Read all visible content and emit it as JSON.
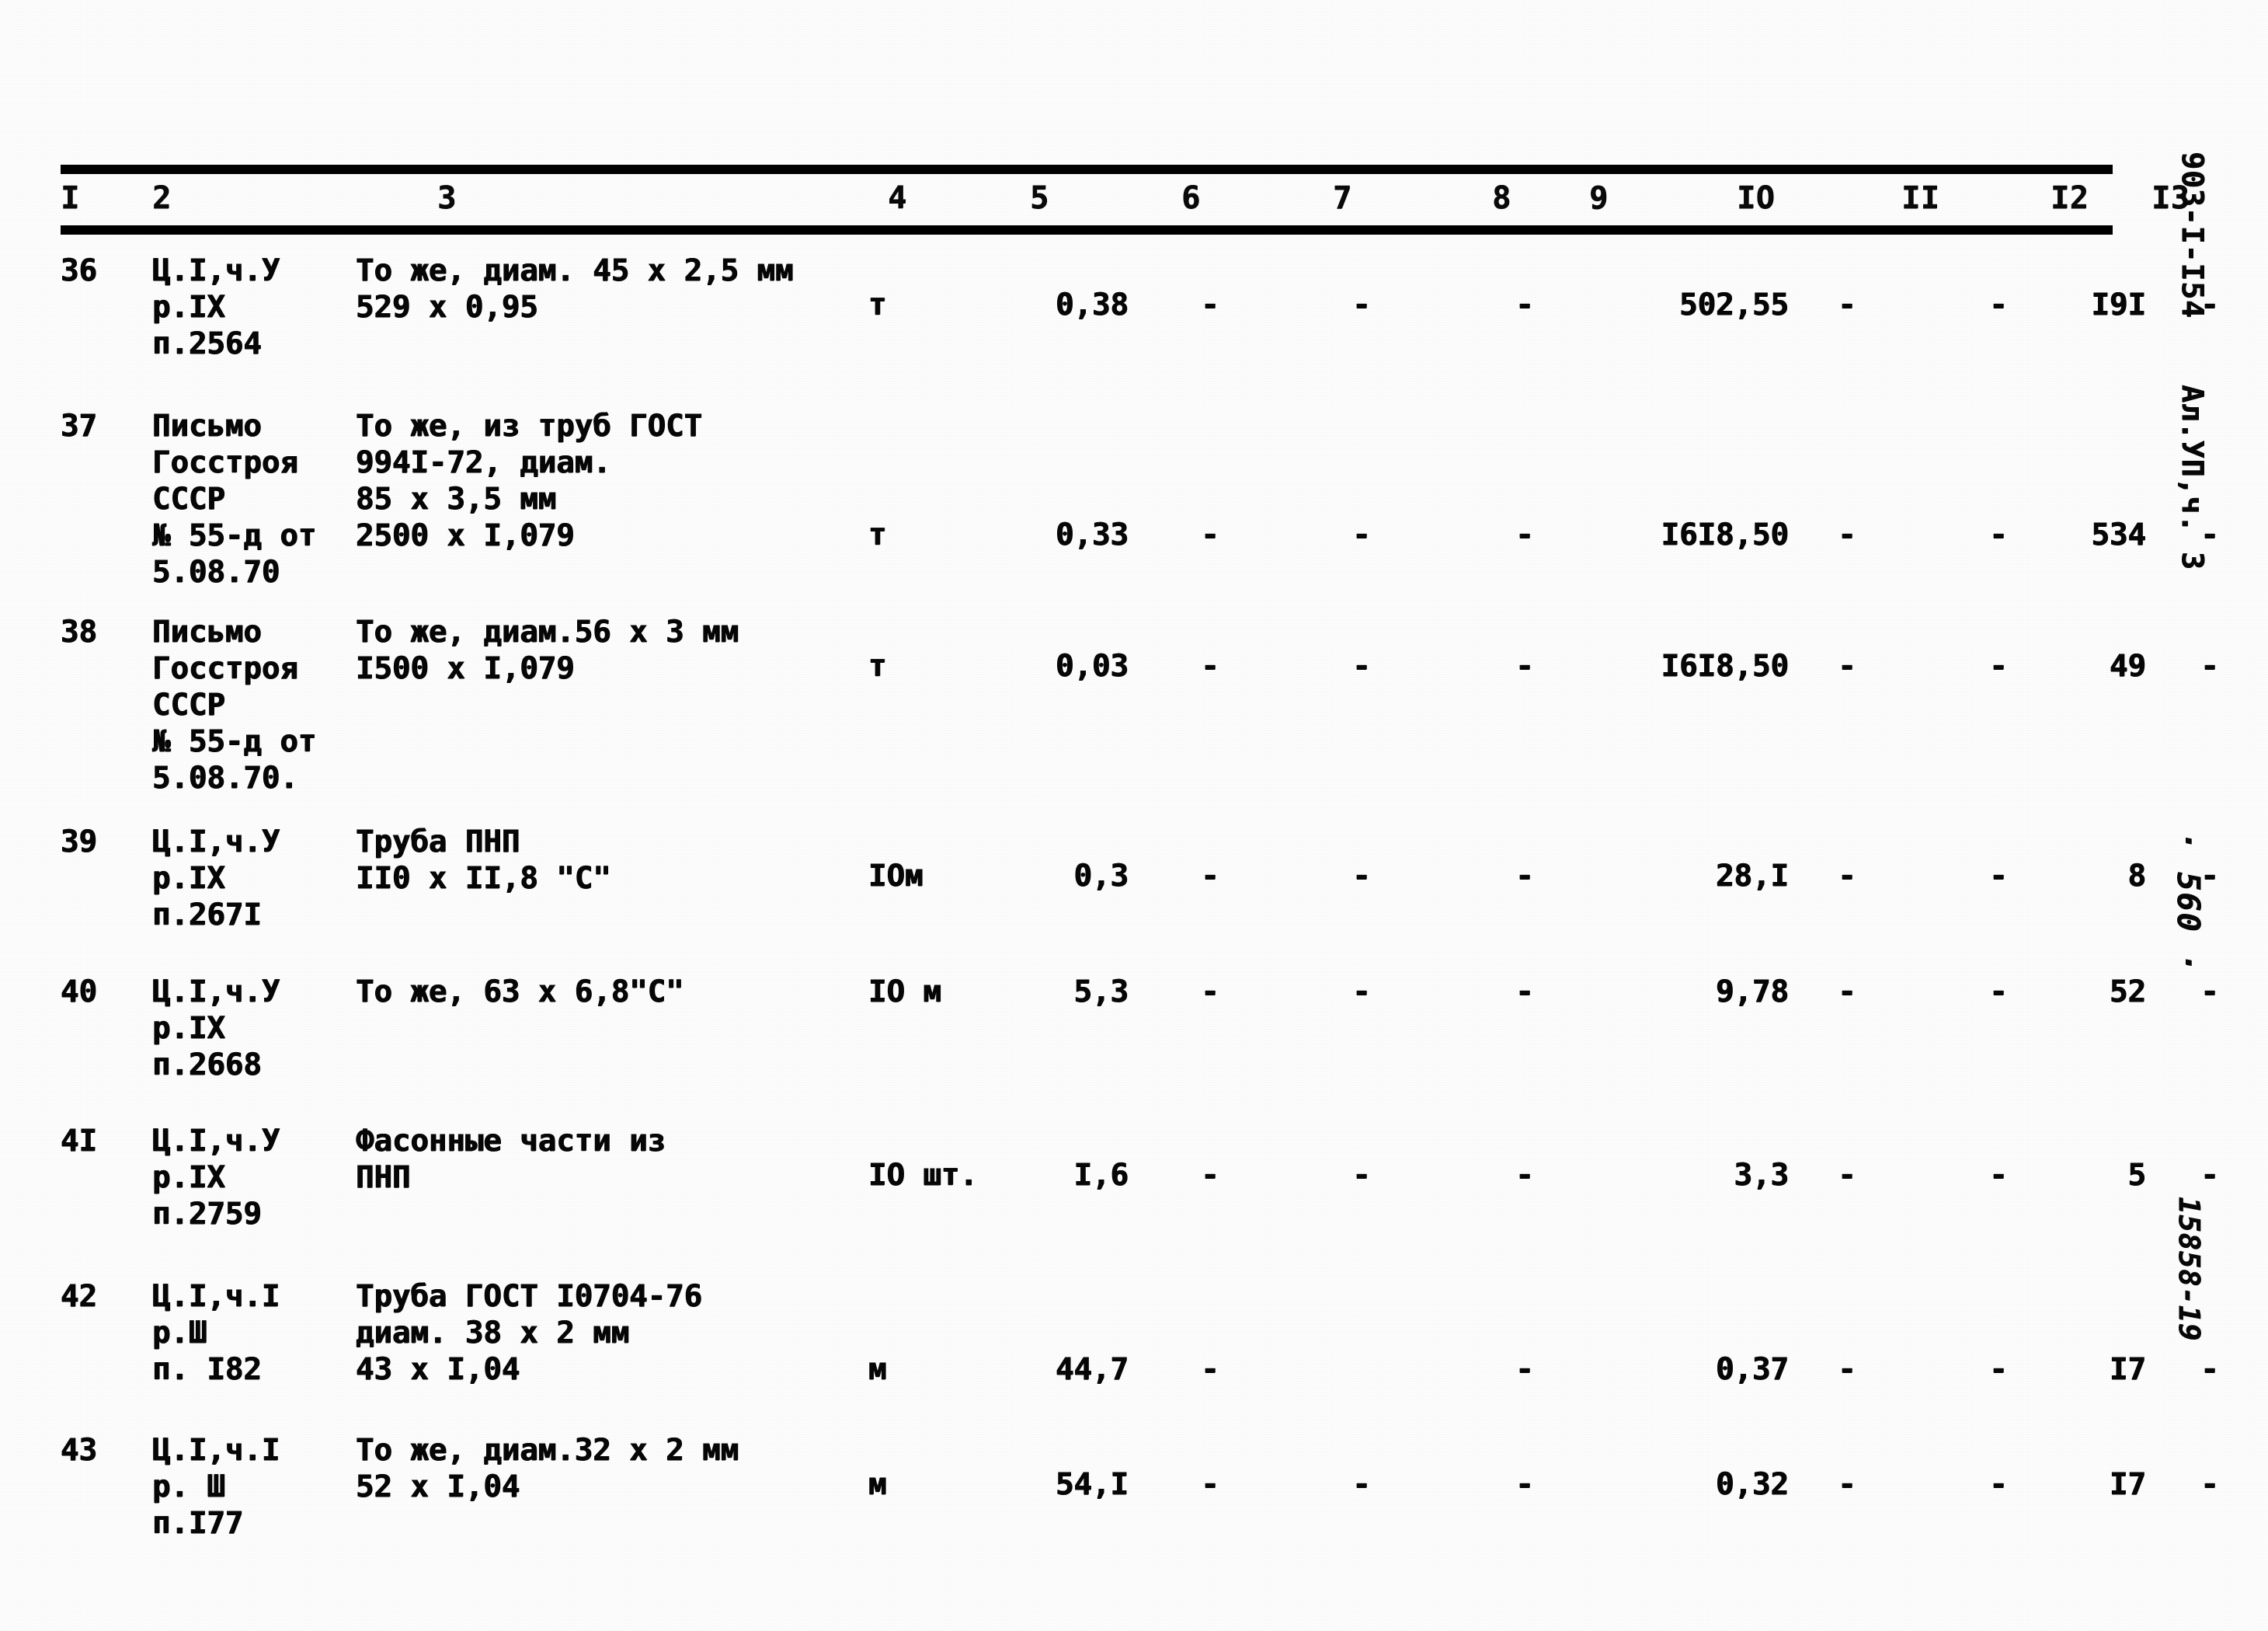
{
  "document": {
    "code": "903-I-I54",
    "album": "Ал.УП,ч. 3",
    "page_number": "· 560 ·",
    "stamp": "15858-19"
  },
  "table": {
    "column_headers": [
      "I",
      "2",
      "3",
      "4",
      "5",
      "6",
      "7",
      "8",
      "9",
      "IO",
      "II",
      "I2",
      "I3"
    ],
    "dash": "-",
    "rows": [
      {
        "num": "36",
        "justification": "Ц.I,ч.У\nр.IX\nп.2564",
        "description": "То же, диам. 45 x 2,5 мм\n529 x 0,95",
        "unit": "т",
        "c5": "0,38",
        "c6": "-",
        "c7": "-",
        "c8": "-",
        "c9": "502,55",
        "c10": "-",
        "c11": "-",
        "c12": "I9I",
        "c13": "-"
      },
      {
        "num": "37",
        "justification": "Письмо\nГосстроя\nСССР\n№ 55-д от\n5.08.70",
        "description": "То же, из труб ГОСТ\n994I-72, диам.\n85 x 3,5 мм\n2500 x I,079",
        "unit": "т",
        "c5": "0,33",
        "c6": "-",
        "c7": "-",
        "c8": "-",
        "c9": "I6I8,50",
        "c10": "-",
        "c11": "-",
        "c12": "534",
        "c13": "-"
      },
      {
        "num": "38",
        "justification": "Письмо\nГосстроя\nСССР\n№ 55-д от\n5.08.70.",
        "description": "То же, диам.56 x 3 мм\nI500 x I,079",
        "unit": "т",
        "c5": "0,03",
        "c6": "-",
        "c7": "-",
        "c8": "-",
        "c9": "I6I8,50",
        "c10": "-",
        "c11": "-",
        "c12": "49",
        "c13": "-"
      },
      {
        "num": "39",
        "justification": "Ц.I,ч.У\nр.IX\nп.267I",
        "description": "Труба ПНП\nII0 x II,8 \"С\"",
        "unit": "IOм",
        "c5": "0,3",
        "c6": "-",
        "c7": "-",
        "c8": "-",
        "c9": "28,I",
        "c10": "-",
        "c11": "-",
        "c12": "8",
        "c13": "-"
      },
      {
        "num": "40",
        "justification": "Ц.I,ч.У\nр.IX\nп.2668",
        "description": "То же, 63 x 6,8\"С\"",
        "unit": "IO м",
        "c5": "5,3",
        "c6": "-",
        "c7": "-",
        "c8": "-",
        "c9": "9,78",
        "c10": "-",
        "c11": "-",
        "c12": "52",
        "c13": "-"
      },
      {
        "num": "4I",
        "justification": "Ц.I,ч.У\nр.IX\nп.2759",
        "description": "Фасонные части из\nПНП",
        "unit": "IO шт.",
        "c5": "I,6",
        "c6": "-",
        "c7": "-",
        "c8": "-",
        "c9": "3,3",
        "c10": "-",
        "c11": "-",
        "c12": "5",
        "c13": "-"
      },
      {
        "num": "42",
        "justification": "Ц.I,ч.I\nр.Ш\nп. I82",
        "description": "Труба ГОСТ I0704-76\nдиам. 38 x 2 мм\n43 x I,04",
        "unit": "м",
        "c5": "44,7",
        "c6": "-",
        "c7": "",
        "c8": "-",
        "c9": "0,37",
        "c10": "-",
        "c11": "-",
        "c12": "I7",
        "c13": "-"
      },
      {
        "num": "43",
        "justification": "Ц.I,ч.I\nр. Ш\nп.I77",
        "description": "То же, диам.32 x 2 мм\n52 x I,04",
        "unit": "м",
        "c5": "54,I",
        "c6": "-",
        "c7": "-",
        "c8": "-",
        "c9": "0,32",
        "c10": "-",
        "c11": "-",
        "c12": "I7",
        "c13": "-"
      }
    ]
  }
}
